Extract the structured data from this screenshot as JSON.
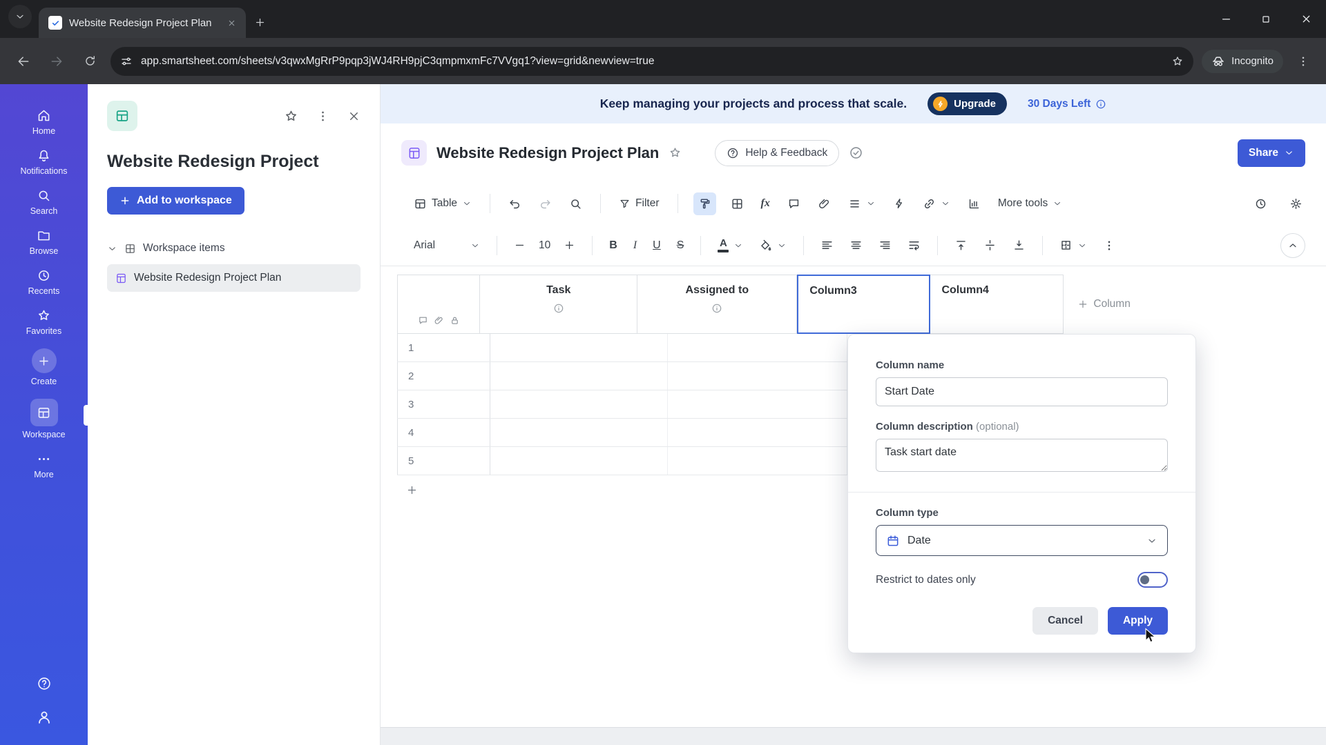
{
  "browser": {
    "tab_title": "Website Redesign Project Plan",
    "url": "app.smartsheet.com/sheets/v3qwxMgRrP9pqp3jWJ4RH9pjC3qmpmxmFc7VVgq1?view=grid&newview=true",
    "incognito_label": "Incognito"
  },
  "nav": {
    "items": [
      {
        "label": "Home",
        "icon": "home-icon"
      },
      {
        "label": "Notifications",
        "icon": "bell-icon"
      },
      {
        "label": "Search",
        "icon": "search-icon"
      },
      {
        "label": "Browse",
        "icon": "folder-icon"
      },
      {
        "label": "Recents",
        "icon": "clock-icon"
      },
      {
        "label": "Favorites",
        "icon": "star-icon"
      },
      {
        "label": "Create",
        "icon": "plus-icon"
      },
      {
        "label": "Workspace",
        "icon": "workspace-grid-icon"
      },
      {
        "label": "More",
        "icon": "ellipsis-icon"
      }
    ]
  },
  "panel": {
    "title": "Website Redesign Project",
    "add_button": "Add to workspace",
    "section": "Workspace items",
    "item": "Website Redesign Project Plan"
  },
  "banner": {
    "message": "Keep managing your projects and process that scale.",
    "upgrade": "Upgrade",
    "days_left": "30 Days Left"
  },
  "sheet": {
    "title": "Website Redesign Project Plan",
    "help": "Help & Feedback",
    "share": "Share"
  },
  "tb1": {
    "table": "Table",
    "filter": "Filter",
    "fx": "fx",
    "more_tools": "More tools"
  },
  "tb2": {
    "font": "Arial",
    "size": "10",
    "bold": "B",
    "italic": "I",
    "underline": "U",
    "strike": "S",
    "color_glyph": "A"
  },
  "grid": {
    "columns": [
      "Task",
      "Assigned to",
      "Column3",
      "Column4"
    ],
    "add_column": "Column",
    "rows": [
      "1",
      "2",
      "3",
      "4",
      "5"
    ]
  },
  "dialog": {
    "name_label": "Column name",
    "name_value": "Start Date",
    "desc_label": "Column description",
    "desc_optional": "(optional)",
    "desc_value": "Task start date",
    "type_label": "Column type",
    "type_value": "Date",
    "restrict_label": "Restrict to dates only",
    "cancel": "Cancel",
    "apply": "Apply"
  },
  "colors": {
    "accent_blue": "#3d5ad6",
    "selected_column_border": "#3f6ad8",
    "banner_bg": "#e8f0fc",
    "upgrade_bg": "#16325f",
    "upgrade_orb": "#f7a828",
    "days_left_text": "#3b63d8",
    "rail_gradient_top": "#5347d3",
    "rail_gradient_bottom": "#3a57e0",
    "browser_frame": "#202124",
    "browser_toolbar": "#35363a"
  }
}
